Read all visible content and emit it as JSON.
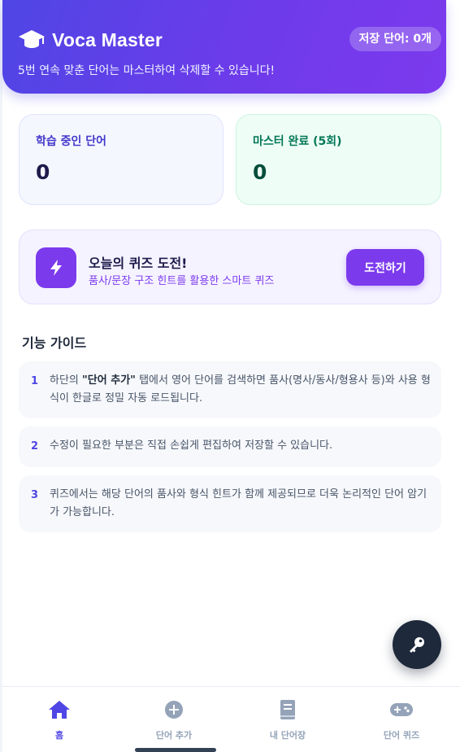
{
  "header": {
    "title": "Voca Master",
    "subtitle": "5번 연속 맞춘 단어는 마스터하여 삭제할 수 있습니다!",
    "saved_badge": "저장 단어: 0개",
    "logo_icon": "graduation-cap-icon"
  },
  "stats": {
    "learning": {
      "label": "학습 중인 단어",
      "value": "0"
    },
    "mastered": {
      "label": "마스터 완료 (5회)",
      "value": "0"
    }
  },
  "quiz_challenge": {
    "icon": "lightning-bolt-icon",
    "title": "오늘의 퀴즈 도전!",
    "subtitle": "품사/문장 구조 힌트를 활용한 스마트 퀴즈",
    "button_label": "도전하기"
  },
  "guide": {
    "title": "기능 가이드",
    "items": [
      {
        "num": "1",
        "pre": "하단의 ",
        "bold": "\"단어 추가\"",
        "post": " 탭에서 영어 단어를 검색하면 품사(명사/동사/형용사 등)와 사용 형식이 한글로 정밀 자동 로드됩니다."
      },
      {
        "num": "2",
        "text": "수정이 필요한 부분은 직접 손쉽게 편집하여 저장할 수 있습니다."
      },
      {
        "num": "3",
        "text": "퀴즈에서는 해당 단어의 품사와 형식 힌트가 함께 제공되므로 더욱 논리적인 단어 암기가 가능합니다."
      }
    ]
  },
  "fab": {
    "icon": "key-icon"
  },
  "bottom_nav": [
    {
      "label": "홈",
      "icon": "home-icon",
      "active": true
    },
    {
      "label": "단어 추가",
      "icon": "plus-circle-icon",
      "active": false
    },
    {
      "label": "내 단어장",
      "icon": "book-icon",
      "active": false
    },
    {
      "label": "단어 퀴즈",
      "icon": "gamepad-icon",
      "active": false
    }
  ],
  "colors": {
    "primary": "#4f46e5",
    "accent": "#7c3aed",
    "mastered": "#047857",
    "fab": "#1e293b"
  }
}
